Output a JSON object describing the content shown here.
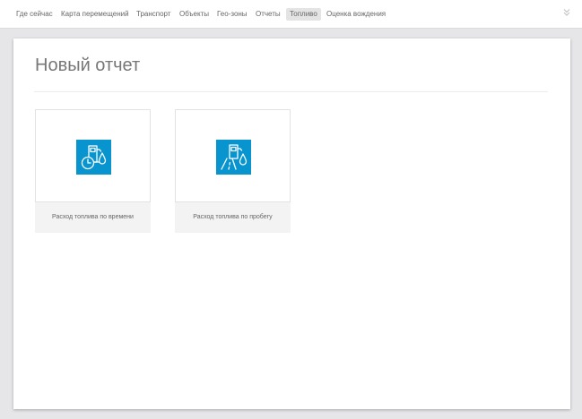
{
  "colors": {
    "accent": "#0894cf",
    "background": "#e6e6e9",
    "panel": "#ffffff",
    "card_footer": "#f3f3f3",
    "active_tab": "#e4e4e4"
  },
  "nav": {
    "items": [
      {
        "label": "Где сейчас"
      },
      {
        "label": "Карта перемещений"
      },
      {
        "label": "Транспорт"
      },
      {
        "label": "Объекты"
      },
      {
        "label": "Гео-зоны"
      },
      {
        "label": "Отчеты"
      },
      {
        "label": "Топливо",
        "active": true
      },
      {
        "label": "Оценка вождения"
      }
    ],
    "collapse_icon": "double-chevron-down-icon"
  },
  "page": {
    "title": "Новый отчет"
  },
  "reports": [
    {
      "label": "Расход топлива по времени",
      "icon": "fuel-time-icon"
    },
    {
      "label": "Расход топлива по пробегу",
      "icon": "fuel-mileage-icon"
    }
  ]
}
